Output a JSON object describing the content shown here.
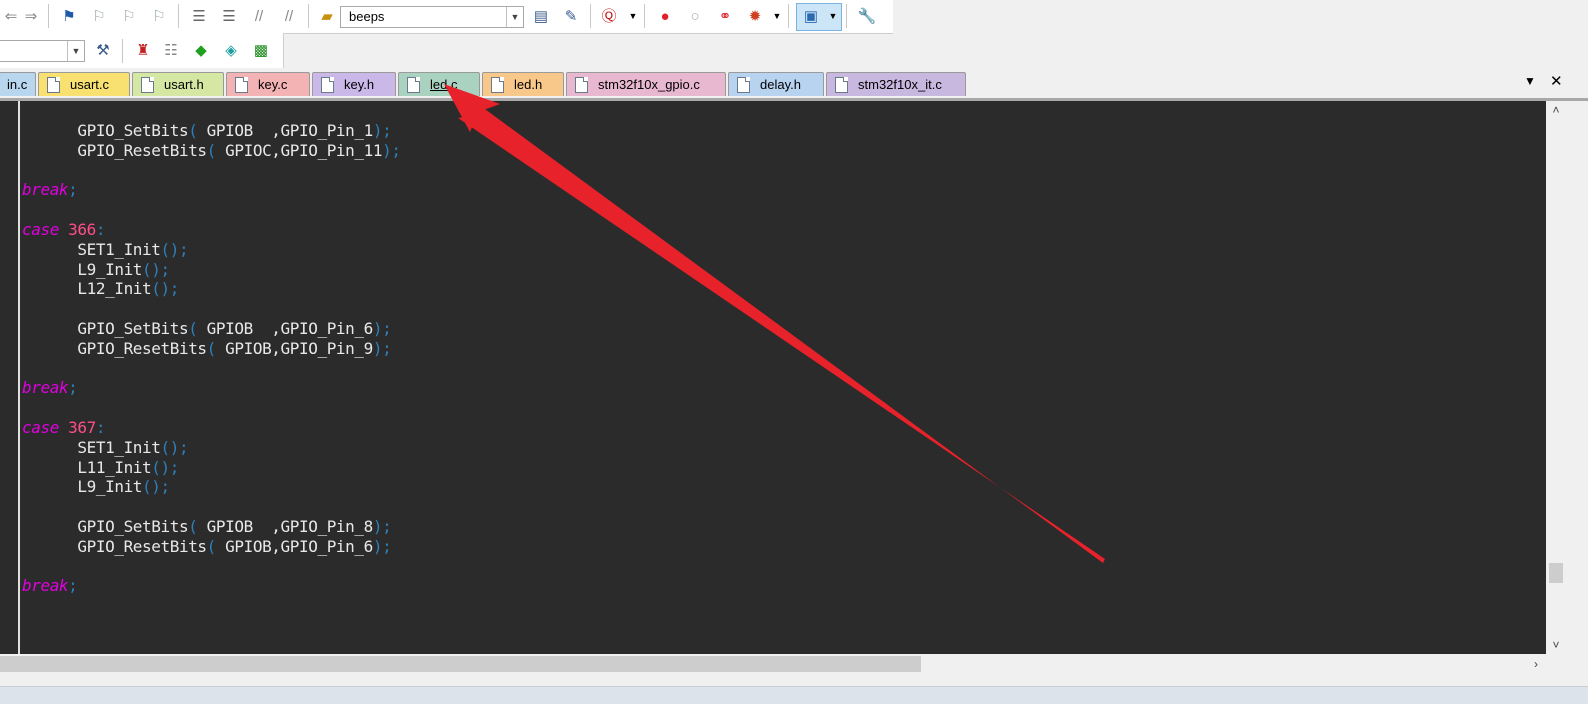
{
  "toolbar": {
    "target_combo_value": "beeps",
    "colors": {
      "red_dot": "#e0202a",
      "accent_blue": "#2f7fb8"
    }
  },
  "tabs": [
    {
      "label": "in.c",
      "color": "#b8d7ee"
    },
    {
      "label": "usart.c",
      "color": "#f8e071"
    },
    {
      "label": "usart.h",
      "color": "#d5e8a3"
    },
    {
      "label": "key.c",
      "color": "#f3b2b4"
    },
    {
      "label": "key.h",
      "color": "#c9b8e8"
    },
    {
      "label": "led.c",
      "color": "#a9d2c0",
      "active": true
    },
    {
      "label": "led.h",
      "color": "#f8c88a"
    },
    {
      "label": "stm32f10x_gpio.c",
      "color": "#e8b8d0"
    },
    {
      "label": "delay.h",
      "color": "#b8d3f0"
    },
    {
      "label": "stm32f10x_it.c",
      "color": "#c8b8e0"
    }
  ],
  "tabbar": {
    "dropdown_glyph": "▼",
    "close_glyph": "✕"
  },
  "code": {
    "line1_fn": "GPIO_SetBits",
    "line1_args": " GPIOB  ,GPIO_Pin_1",
    "line2_fn": "GPIO_ResetBits",
    "line2_args": " GPIOC,GPIO_Pin_11",
    "kw_break": "break",
    "kw_case": "case",
    "case_366": "366",
    "fn_set1": "SET1_Init",
    "fn_l9": "L9_Init",
    "fn_l12": "L12_Init",
    "line_b_fn1": "GPIO_SetBits",
    "line_b_args1": " GPIOB  ,GPIO_Pin_6",
    "line_b_fn2": "GPIO_ResetBits",
    "line_b_args2": " GPIOB,GPIO_Pin_9",
    "case_367": "367",
    "fn_l11": "L11_Init",
    "line_c_fn1": "GPIO_SetBits",
    "line_c_args1": " GPIOB  ,GPIO_Pin_8",
    "line_c_fn2": "GPIO_ResetBits",
    "line_c_args2": " GPIOB,GPIO_Pin_6"
  },
  "scroll": {
    "up": "˄",
    "down": "˅",
    "right": "›"
  }
}
